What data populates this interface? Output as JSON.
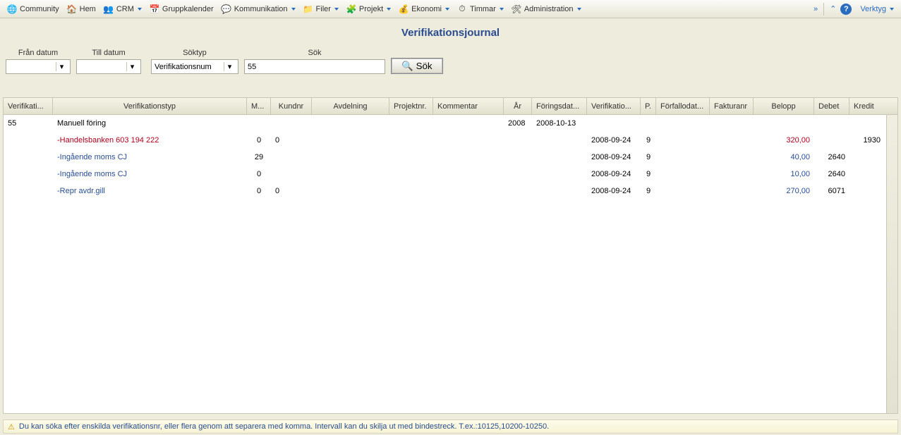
{
  "toolbar": {
    "items": [
      {
        "icon": "🌐",
        "label": "Community",
        "caret": false
      },
      {
        "icon": "🏠",
        "label": "Hem",
        "caret": false
      },
      {
        "icon": "👥",
        "label": "CRM",
        "caret": true
      },
      {
        "icon": "📅",
        "label": "Gruppkalender",
        "caret": false
      },
      {
        "icon": "💬",
        "label": "Kommunikation",
        "caret": true
      },
      {
        "icon": "📁",
        "label": "Filer",
        "caret": true
      },
      {
        "icon": "🧩",
        "label": "Projekt",
        "caret": true
      },
      {
        "icon": "💰",
        "label": "Ekonomi",
        "caret": true
      },
      {
        "icon": "⏱",
        "label": "Timmar",
        "caret": true
      },
      {
        "icon": "🛠",
        "label": "Administration",
        "caret": true
      }
    ],
    "tools_label": "Verktyg"
  },
  "page_title": "Verifikationsjournal",
  "search": {
    "from_label": "Från datum",
    "from_value": "",
    "to_label": "Till datum",
    "to_value": "",
    "soktyp_label": "Söktyp",
    "soktyp_value": "Verifikationsnum",
    "sok_field_label": "Sök",
    "sok_value": "55",
    "sok_button": "Sök"
  },
  "columns": {
    "ver": "Verifikati...",
    "vtyp": "Verifikationstyp",
    "m": "M...",
    "kund": "Kundnr",
    "avd": "Avdelning",
    "proj": "Projektnr.",
    "kom": "Kommentar",
    "ar": "År",
    "for": "Föringsdat...",
    "vdat": "Verifikatio...",
    "p": "P.",
    "forf": "Förfallodat...",
    "fakt": "Fakturanr",
    "bel": "Belopp",
    "deb": "Debet",
    "kre": "Kredit"
  },
  "rows": {
    "group": {
      "ver": "55",
      "vtyp": "Manuell föring",
      "ar": "2008",
      "for": "2008-10-13"
    },
    "lines": [
      {
        "vtyp": "-Handelsbanken 603 194 222",
        "red": true,
        "m": "0",
        "kund": "0",
        "vdat": "2008-09-24",
        "p": "9",
        "belopp": "320,00",
        "deb": "",
        "kre": "1930"
      },
      {
        "vtyp": "-Ingående moms CJ",
        "red": false,
        "m": "29",
        "kund": "",
        "vdat": "2008-09-24",
        "p": "9",
        "belopp": "40,00",
        "deb": "2640",
        "kre": ""
      },
      {
        "vtyp": "-Ingående moms CJ",
        "red": false,
        "m": "0",
        "kund": "",
        "vdat": "2008-09-24",
        "p": "9",
        "belopp": "10,00",
        "deb": "2640",
        "kre": ""
      },
      {
        "vtyp": "-Repr avdr.gill",
        "red": false,
        "m": "0",
        "kund": "0",
        "vdat": "2008-09-24",
        "p": "9",
        "belopp": "270,00",
        "deb": "6071",
        "kre": ""
      }
    ]
  },
  "footer": "Du kan söka efter enskilda verifikationsnr, eller flera genom att separera med komma. Intervall kan du skilja ut med bindestreck. T.ex.:10125,10200-10250."
}
